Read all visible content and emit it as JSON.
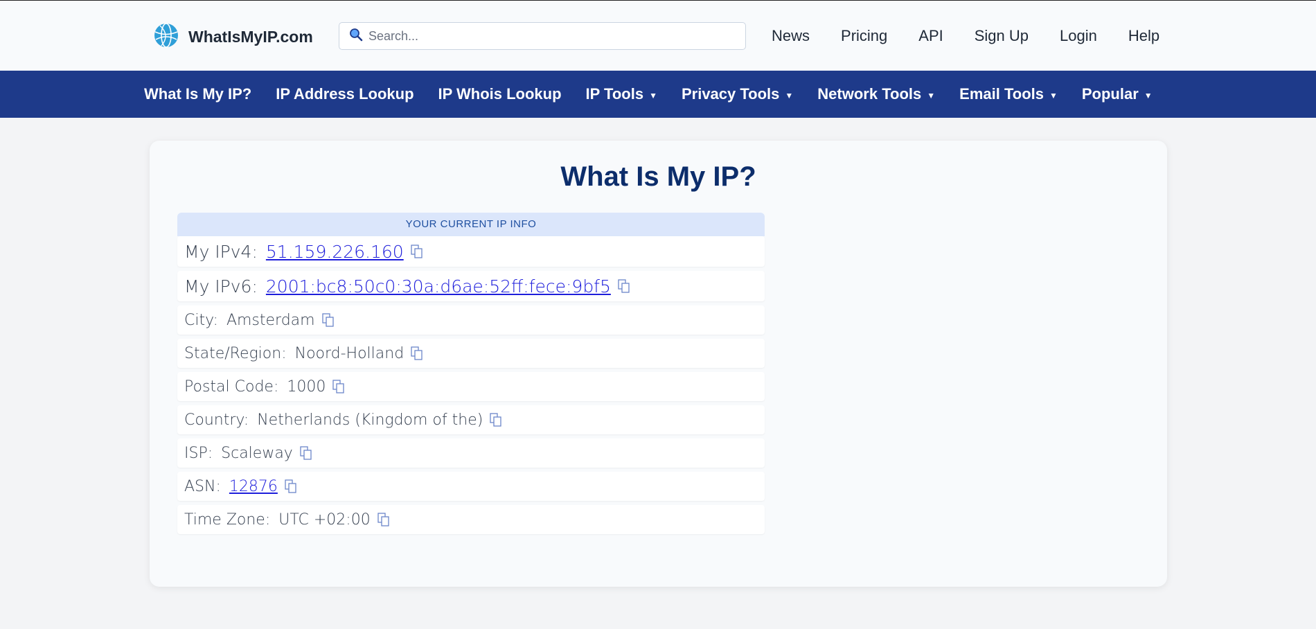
{
  "header": {
    "logo_text": "WhatIsMyIP.com",
    "search_placeholder": "Search...",
    "links": [
      "News",
      "Pricing",
      "API",
      "Sign Up",
      "Login",
      "Help"
    ]
  },
  "nav": {
    "items": [
      {
        "label": "What Is My IP?",
        "dropdown": false
      },
      {
        "label": "IP Address Lookup",
        "dropdown": false
      },
      {
        "label": "IP Whois Lookup",
        "dropdown": false
      },
      {
        "label": "IP Tools",
        "dropdown": true
      },
      {
        "label": "Privacy Tools",
        "dropdown": true
      },
      {
        "label": "Network Tools",
        "dropdown": true
      },
      {
        "label": "Email Tools",
        "dropdown": true
      },
      {
        "label": "Popular",
        "dropdown": true
      }
    ],
    "caret": "▼"
  },
  "main": {
    "title": "What Is My IP?",
    "info_header": "YOUR CURRENT IP INFO",
    "rows": {
      "ipv4": {
        "label": "My IPv4:",
        "value": "51.159.226.160"
      },
      "ipv6": {
        "label": "My IPv6:",
        "value": "2001:bc8:50c0:30a:d6ae:52ff:fece:9bf5"
      },
      "city": {
        "label": "City:",
        "value": "Amsterdam"
      },
      "region": {
        "label": "State/Region:",
        "value": "Noord-Holland"
      },
      "postal": {
        "label": "Postal Code:",
        "value": "1000"
      },
      "country": {
        "label": "Country:",
        "value": "Netherlands (Kingdom of the)"
      },
      "isp": {
        "label": "ISP:",
        "value": "Scaleway"
      },
      "asn": {
        "label": "ASN:",
        "value": "12876"
      },
      "timezone": {
        "label": "Time Zone:",
        "value": "UTC +02:00"
      }
    }
  },
  "colors": {
    "nav_bg": "#1e3a8a",
    "title": "#0c2d6b",
    "link": "#1d1ddb",
    "info_header_bg": "#dbe6fb"
  },
  "icons": {
    "logo": "globe-icon",
    "search": "search-icon",
    "copy": "copy-icon"
  }
}
